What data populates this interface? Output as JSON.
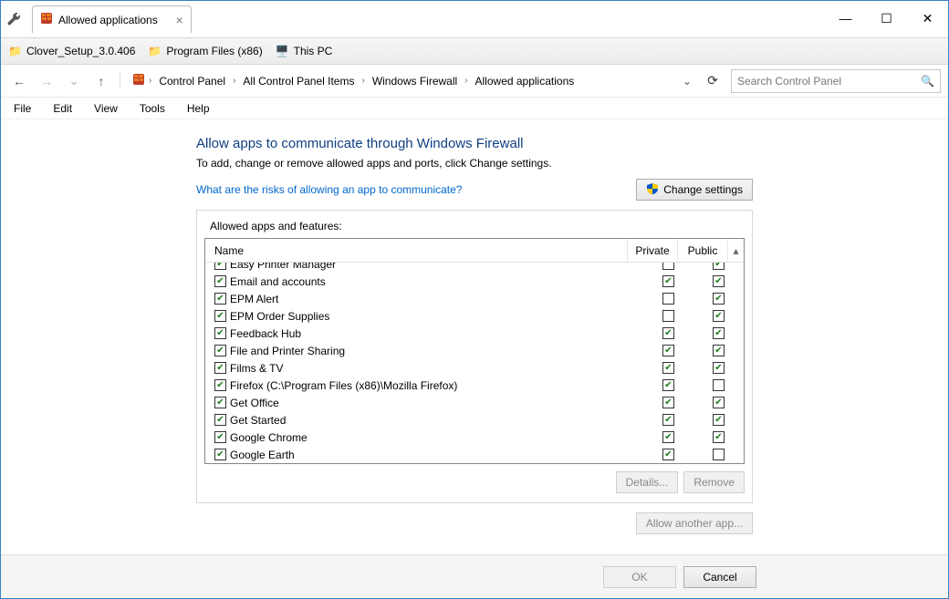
{
  "window": {
    "tab_title": "Allowed applications",
    "controls": {
      "min": "—",
      "max": "☐",
      "close": "✕"
    }
  },
  "bookmarks": [
    {
      "icon": "folder",
      "label": "Clover_Setup_3.0.406"
    },
    {
      "icon": "folder",
      "label": "Program Files (x86)"
    },
    {
      "icon": "monitor",
      "label": "This PC"
    }
  ],
  "breadcrumb": {
    "items": [
      "Control Panel",
      "All Control Panel Items",
      "Windows Firewall",
      "Allowed applications"
    ]
  },
  "search": {
    "placeholder": "Search Control Panel"
  },
  "menu": [
    "File",
    "Edit",
    "View",
    "Tools",
    "Help"
  ],
  "page": {
    "heading": "Allow apps to communicate through Windows Firewall",
    "subtext": "To add, change or remove allowed apps and ports, click Change settings.",
    "risks_link": "What are the risks of allowing an app to communicate?",
    "change_settings": "Change settings",
    "panel_label": "Allowed apps and features:",
    "col_name": "Name",
    "col_private": "Private",
    "col_public": "Public",
    "details": "Details...",
    "remove": "Remove",
    "allow_another": "Allow another app..."
  },
  "apps": [
    {
      "name": "Easy Printer Manager",
      "enabled": true,
      "private": false,
      "public": true
    },
    {
      "name": "Email and accounts",
      "enabled": true,
      "private": true,
      "public": true
    },
    {
      "name": "EPM Alert",
      "enabled": true,
      "private": false,
      "public": true
    },
    {
      "name": "EPM Order Supplies",
      "enabled": true,
      "private": false,
      "public": true
    },
    {
      "name": "Feedback Hub",
      "enabled": true,
      "private": true,
      "public": true
    },
    {
      "name": "File and Printer Sharing",
      "enabled": true,
      "private": true,
      "public": true
    },
    {
      "name": "Films & TV",
      "enabled": true,
      "private": true,
      "public": true
    },
    {
      "name": "Firefox (C:\\Program Files (x86)\\Mozilla Firefox)",
      "enabled": true,
      "private": true,
      "public": false
    },
    {
      "name": "Get Office",
      "enabled": true,
      "private": true,
      "public": true
    },
    {
      "name": "Get Started",
      "enabled": true,
      "private": true,
      "public": true
    },
    {
      "name": "Google Chrome",
      "enabled": true,
      "private": true,
      "public": true
    },
    {
      "name": "Google Earth",
      "enabled": true,
      "private": true,
      "public": false
    }
  ],
  "footer": {
    "ok": "OK",
    "cancel": "Cancel"
  }
}
